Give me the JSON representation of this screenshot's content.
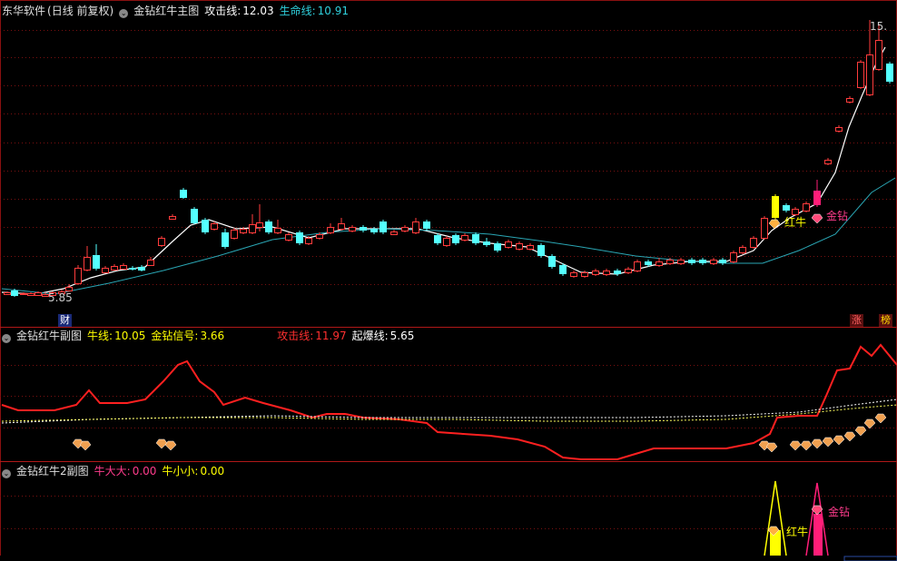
{
  "main_panel": {
    "software": "东华软件",
    "period": "(日线 前复权)",
    "indicator_name": "金钻红牛主图",
    "attack_label": "攻击线:",
    "attack_value": "12.03",
    "life_label": "生命线:",
    "life_value": "10.91",
    "high_marker": "15.",
    "low_marker": "5.85",
    "finance_tag": "财",
    "rise_tag": "涨",
    "rank_tag": "榜",
    "signal_hongniu": "红牛",
    "signal_jinzuan": "金钻",
    "colors": {
      "up": "#ff3c3c",
      "down": "#54ffff",
      "attack": "#ffffff",
      "life": "#2aa6b4",
      "grid": "#7a1010",
      "yellow_bar": "#ffff00",
      "magenta_bar": "#ff1e78"
    }
  },
  "sub_panel_1": {
    "indicator_name": "金钻红牛副图",
    "bull_label": "牛线:",
    "bull_value": "10.05",
    "signal_label": "金钻信号:",
    "signal_value": "3.66",
    "attack_label": "攻击线:",
    "attack_value": "11.97",
    "burst_label": "起爆线:",
    "burst_value": "5.65"
  },
  "sub_panel_2": {
    "indicator_name": "金钻红牛2副图",
    "big_label": "牛大大:",
    "big_value": "0.00",
    "small_label": "牛小小:",
    "small_value": "0.00",
    "signal_hongniu": "红牛",
    "signal_jinzuan": "金钻"
  }
}
